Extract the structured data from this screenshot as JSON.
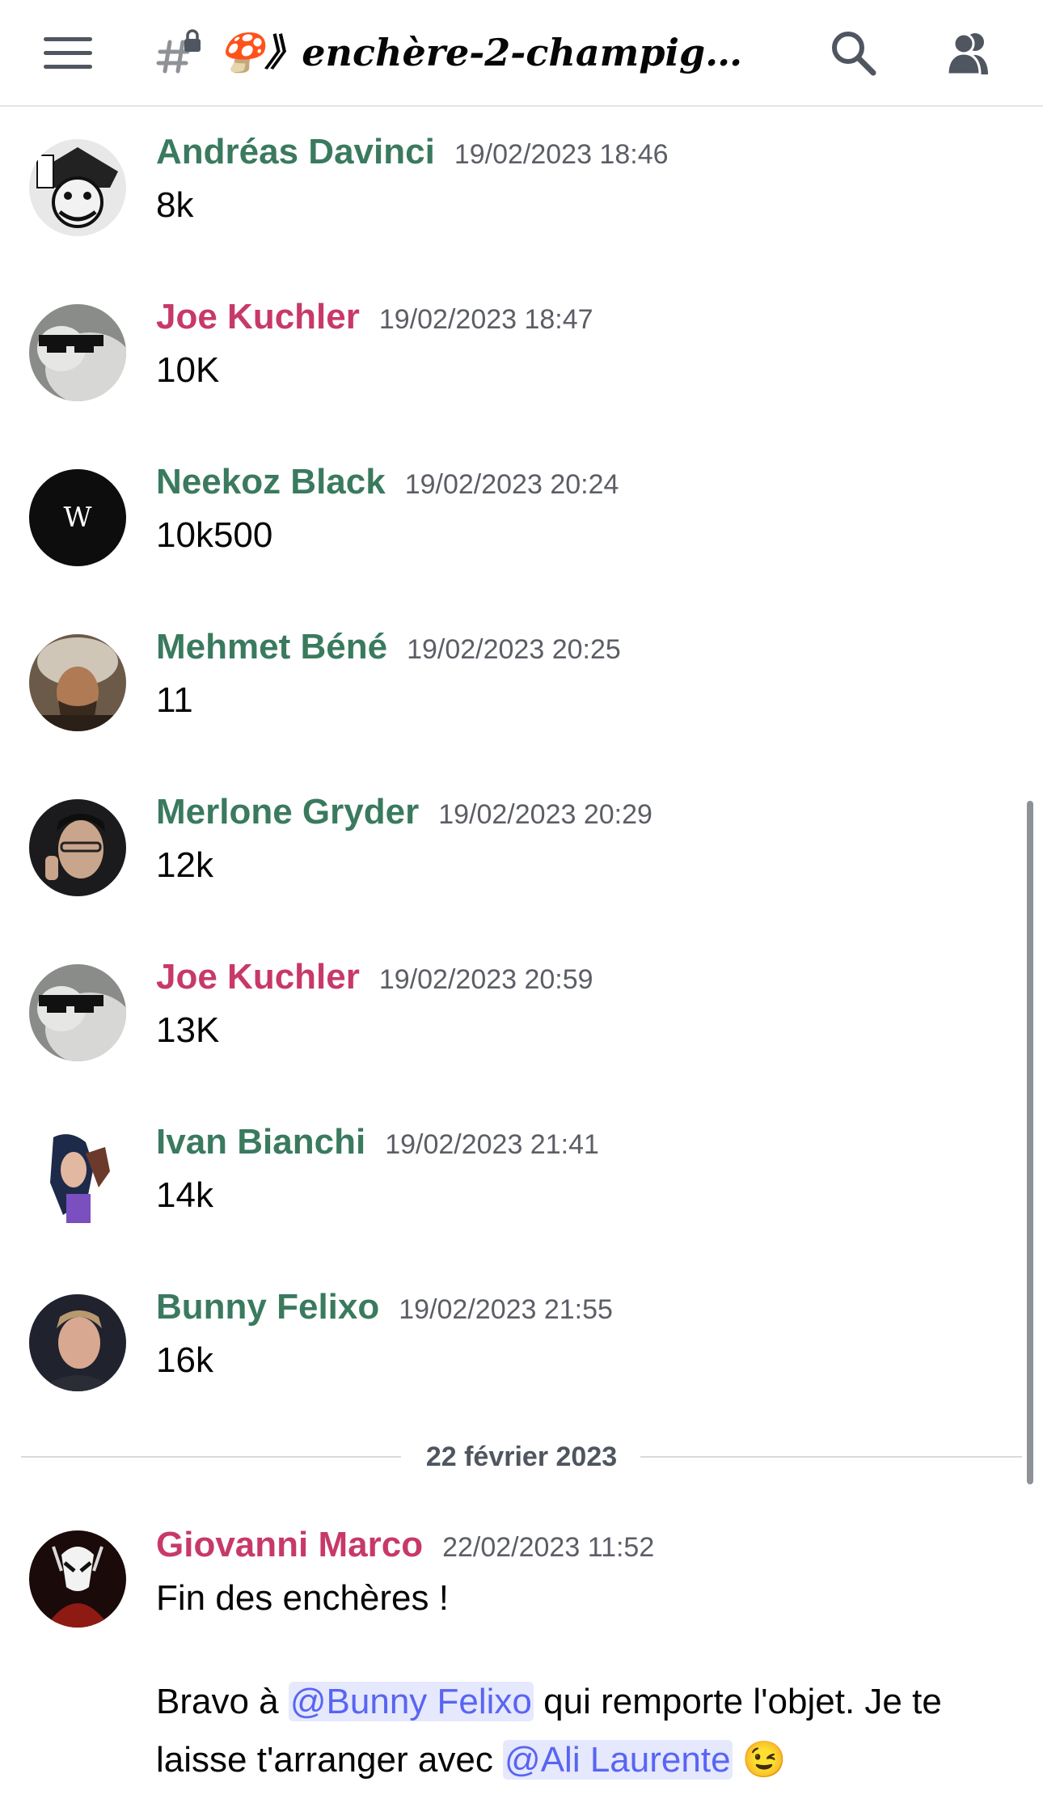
{
  "header": {
    "channel_name": "🍄》enchère-2-champig…",
    "icons": [
      "menu-icon",
      "locked-hash-icon",
      "search-icon",
      "members-icon"
    ]
  },
  "messages": [
    {
      "author": "Andréas Davinci",
      "timestamp": "19/02/2023 18:46",
      "text": "8k",
      "color": "#3a7a5e"
    },
    {
      "author": "Joe Kuchler",
      "timestamp": "19/02/2023 18:47",
      "text": "10K",
      "color": "#c7396a"
    },
    {
      "author": "Neekoz Black",
      "timestamp": "19/02/2023 20:24",
      "text": "10k500",
      "color": "#3a7a5e"
    },
    {
      "author": "Mehmet Béné",
      "timestamp": "19/02/2023 20:25",
      "text": "11",
      "color": "#3a7a5e"
    },
    {
      "author": "Merlone Gryder",
      "timestamp": "19/02/2023 20:29",
      "text": "12k",
      "color": "#3a7a5e"
    },
    {
      "author": "Joe Kuchler",
      "timestamp": "19/02/2023 20:59",
      "text": "13K",
      "color": "#c7396a"
    },
    {
      "author": "Ivan Bianchi",
      "timestamp": "19/02/2023 21:41",
      "text": "14k",
      "color": "#3a7a5e"
    },
    {
      "author": "Bunny Felixo",
      "timestamp": "19/02/2023 21:55",
      "text": "16k",
      "color": "#3a7a5e"
    }
  ],
  "date_divider": "22 février 2023",
  "last_message": {
    "author": "Giovanni Marco",
    "timestamp": "22/02/2023 11:52",
    "line1": "Fin des enchères !",
    "p2_a": "Bravo à ",
    "mention1": "@Bunny Felixo",
    "p2_b": " qui remporte l'objet. Je te",
    "p3_a": "laisse t'arranger avec ",
    "mention2": "@Ali Laurente",
    "emoji": "😉",
    "color": "#c7396a"
  },
  "avatar_letters": {
    "neekoz": "W"
  }
}
